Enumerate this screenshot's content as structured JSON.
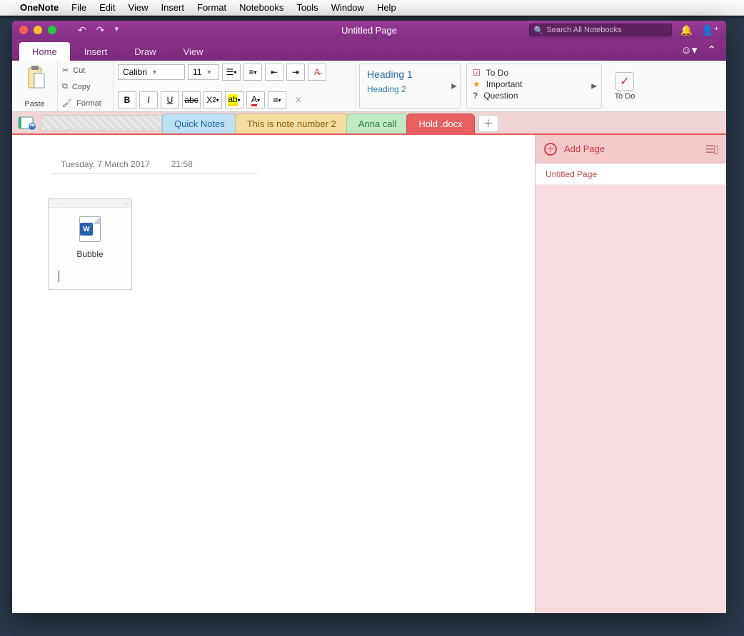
{
  "menubar": {
    "app": "OneNote",
    "items": [
      "File",
      "Edit",
      "View",
      "Insert",
      "Format",
      "Notebooks",
      "Tools",
      "Window",
      "Help"
    ]
  },
  "window": {
    "title": "Untitled Page",
    "search_placeholder": "Search All Notebooks"
  },
  "ribbon_tabs": {
    "items": [
      "Home",
      "Insert",
      "Draw",
      "View"
    ],
    "active": "Home"
  },
  "ribbon": {
    "paste": "Paste",
    "cut": "Cut",
    "copy": "Copy",
    "format": "Format",
    "font_name": "Calibri",
    "font_size": "11",
    "heading1": "Heading 1",
    "heading2": "Heading 2",
    "tag_todo": "To Do",
    "tag_important": "Important",
    "tag_question": "Question",
    "todo_label": "To Do"
  },
  "sections": {
    "items": [
      {
        "label": "Quick Notes",
        "cls": "blue"
      },
      {
        "label": "This is note number 2",
        "cls": "yellow"
      },
      {
        "label": "Anna call",
        "cls": "green"
      },
      {
        "label": "Hold .docx",
        "cls": "red"
      }
    ]
  },
  "note": {
    "date": "Tuesday, 7 March 2017",
    "time": "21:58",
    "attachment_name": "Bubble"
  },
  "page_pane": {
    "add_label": "Add Page",
    "pages": [
      "Untitled Page"
    ]
  }
}
